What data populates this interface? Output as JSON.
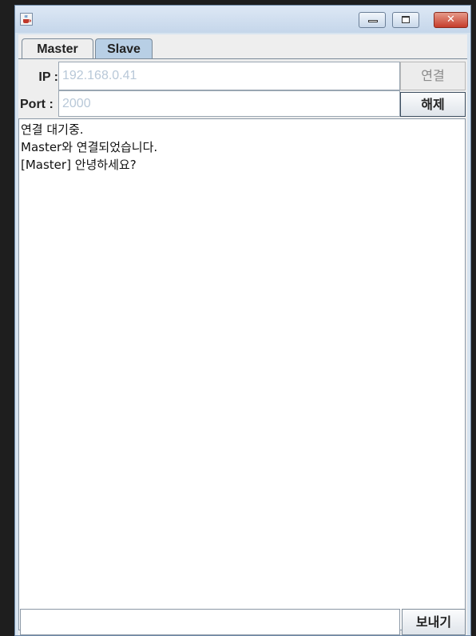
{
  "window": {
    "title": "",
    "icon": "java-cup-icon",
    "controls": [
      "minimize-icon",
      "maximize-icon",
      "close-icon"
    ],
    "close_glyph": "✕"
  },
  "tabs": [
    {
      "label": "Master",
      "selected": false
    },
    {
      "label": "Slave",
      "selected": true
    }
  ],
  "form": {
    "ip_label": "IP :",
    "ip_value": "192.168.0.41",
    "port_label": "Port :",
    "port_value": "2000",
    "connect_label": "연결",
    "disconnect_label": "해제"
  },
  "log": {
    "lines": [
      "연결 대기중.",
      "Master와 연결되었습니다.",
      "[Master] 안녕하세요?"
    ]
  },
  "message": {
    "value": "",
    "send_label": "보내기"
  }
}
